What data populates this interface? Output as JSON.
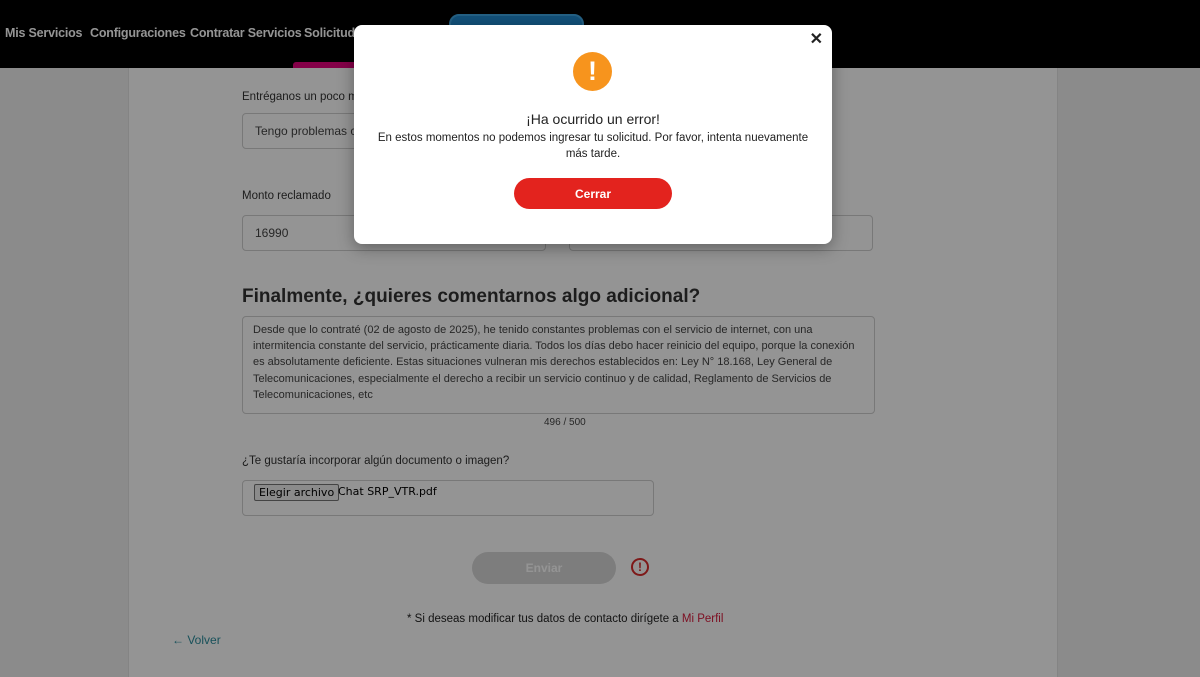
{
  "nav": {
    "items": [
      "Mis Servicios",
      "Configuraciones",
      "Contratar Servicios",
      "Solicitudes"
    ]
  },
  "form": {
    "details_label": "Entréganos un poco más",
    "details_value": "Tengo problemas con",
    "amount_label": "Monto reclamado",
    "amount_value": "16990",
    "final_title": "Finalmente, ¿quieres comentarnos algo adicional?",
    "comment_text": "Desde que lo contraté (02 de agosto de 2025), he tenido constantes problemas con el servicio de internet, con una intermitencia constante del servicio, prácticamente diaria. Todos los días debo hacer reinicio del equipo, porque la conexión es absolutamente deficiente. Estas situaciones vulneran mis derechos establecidos en: Ley N° 18.168, Ley General de Telecomunicaciones, especialmente el derecho a recibir un servicio continuo y de calidad, Reglamento de Servicios de Telecomunicaciones, etc",
    "char_counter": "496 / 500",
    "attach_label": "¿Te gustaría incorporar algún documento o imagen?",
    "file_button_label": "Elegir archivo",
    "file_name": "Chat SRP_VTR.pdf",
    "send_label": "Enviar",
    "error_icon_glyph": "!"
  },
  "footer": {
    "contact_note": "* Si deseas modificar tus datos de contacto dirígete a",
    "contact_link": "Mi Perfil",
    "back_label": "Volver",
    "back_arrow": "←"
  },
  "modal": {
    "close_glyph": "✕",
    "icon_glyph": "!",
    "title": "¡Ha ocurrido un error!",
    "message": "En estos momentos no podemos ingresar tu solicitud. Por favor, intenta nuevamente más tarde.",
    "button_label": "Cerrar"
  },
  "colors": {
    "accent_magenta": "#e4007c",
    "error_red": "#e3231e",
    "warning_orange": "#f7941d",
    "link_teal": "#2a8c9c"
  }
}
